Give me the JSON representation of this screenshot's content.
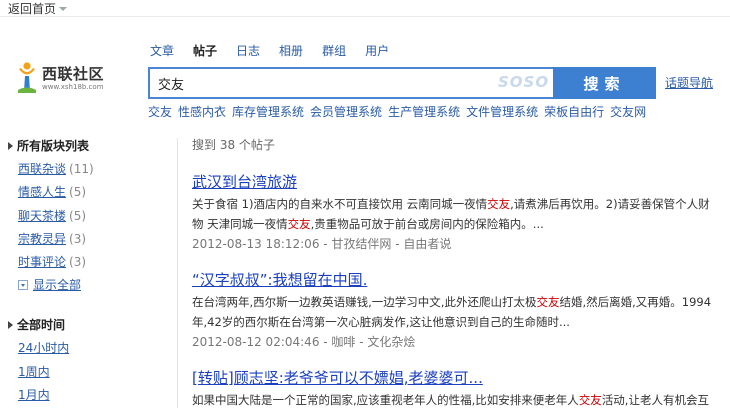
{
  "top": {
    "back_home": "返回首页"
  },
  "logo": {
    "title": "西联社区",
    "url": "www.xsh18b.com"
  },
  "tabs": [
    {
      "label": "文章",
      "active": false
    },
    {
      "label": "帖子",
      "active": true
    },
    {
      "label": "日志",
      "active": false
    },
    {
      "label": "相册",
      "active": false
    },
    {
      "label": "群组",
      "active": false
    },
    {
      "label": "用户",
      "active": false
    }
  ],
  "search": {
    "value": "交友",
    "watermark": "SOSO",
    "button": "搜索",
    "topic_nav": "话题导航"
  },
  "related": [
    "交友",
    "性感内衣",
    "库存管理系统",
    "会员管理系统",
    "生产管理系统",
    "文件管理系统",
    "荣板自由行",
    "交友网"
  ],
  "sidebar": {
    "section1_title": "所有版块列表",
    "forums": [
      {
        "name": "西联杂谈",
        "count": "(11)"
      },
      {
        "name": "情感人生",
        "count": "(5)"
      },
      {
        "name": "聊天茶楼",
        "count": "(5)"
      },
      {
        "name": "宗教灵异",
        "count": "(3)"
      },
      {
        "name": "时事评论",
        "count": "(3)"
      }
    ],
    "show_all": "显示全部",
    "section2_title": "全部时间",
    "times": [
      "24小时内",
      "1周内",
      "1月内"
    ]
  },
  "results": {
    "count_text": "搜到 38 个帖子",
    "items": [
      {
        "title": "武汉到台湾旅游",
        "line1": [
          "关于食宿 1)酒店内的自来水不可直接饮用 云南同城一夜情",
          "交友",
          ",请煮沸后再饮用。2)请妥善保管个人财"
        ],
        "line2": [
          "物 天津同城一夜情",
          "交友",
          ",贵重物品可放于前台或房间内的保险箱内。..."
        ],
        "meta": "2012-08-13 18:12:06 - 甘孜结伴网 - 自由者说"
      },
      {
        "title": "“汉字叔叔”:我想留在中国.",
        "line1": [
          "在台湾两年,西尔斯一边教英语赚钱,一边学习中文,此外还爬山打太极",
          "交友",
          "结婚,然后离婚,又再婚。1994"
        ],
        "line2": [
          "年,42岁的西尔斯在台湾第一次心脏病发作,这让他意识到自己的生命随时...",
          "",
          ""
        ],
        "meta": "2012-08-12 02:04:46 - 咖啡 - 文化杂烩"
      },
      {
        "title": "[转贴]顾志坚:老爷爷可以不嫖娼,老婆婆可...",
        "line1": [
          "如果中国大陆是一个正常的国家,应该重视老年人的性福,比如安排来便老年人",
          "交友",
          "活动,让老人有机会互"
        ],
        "line2": [
          "",
          "",
          ""
        ],
        "meta": ""
      }
    ]
  }
}
